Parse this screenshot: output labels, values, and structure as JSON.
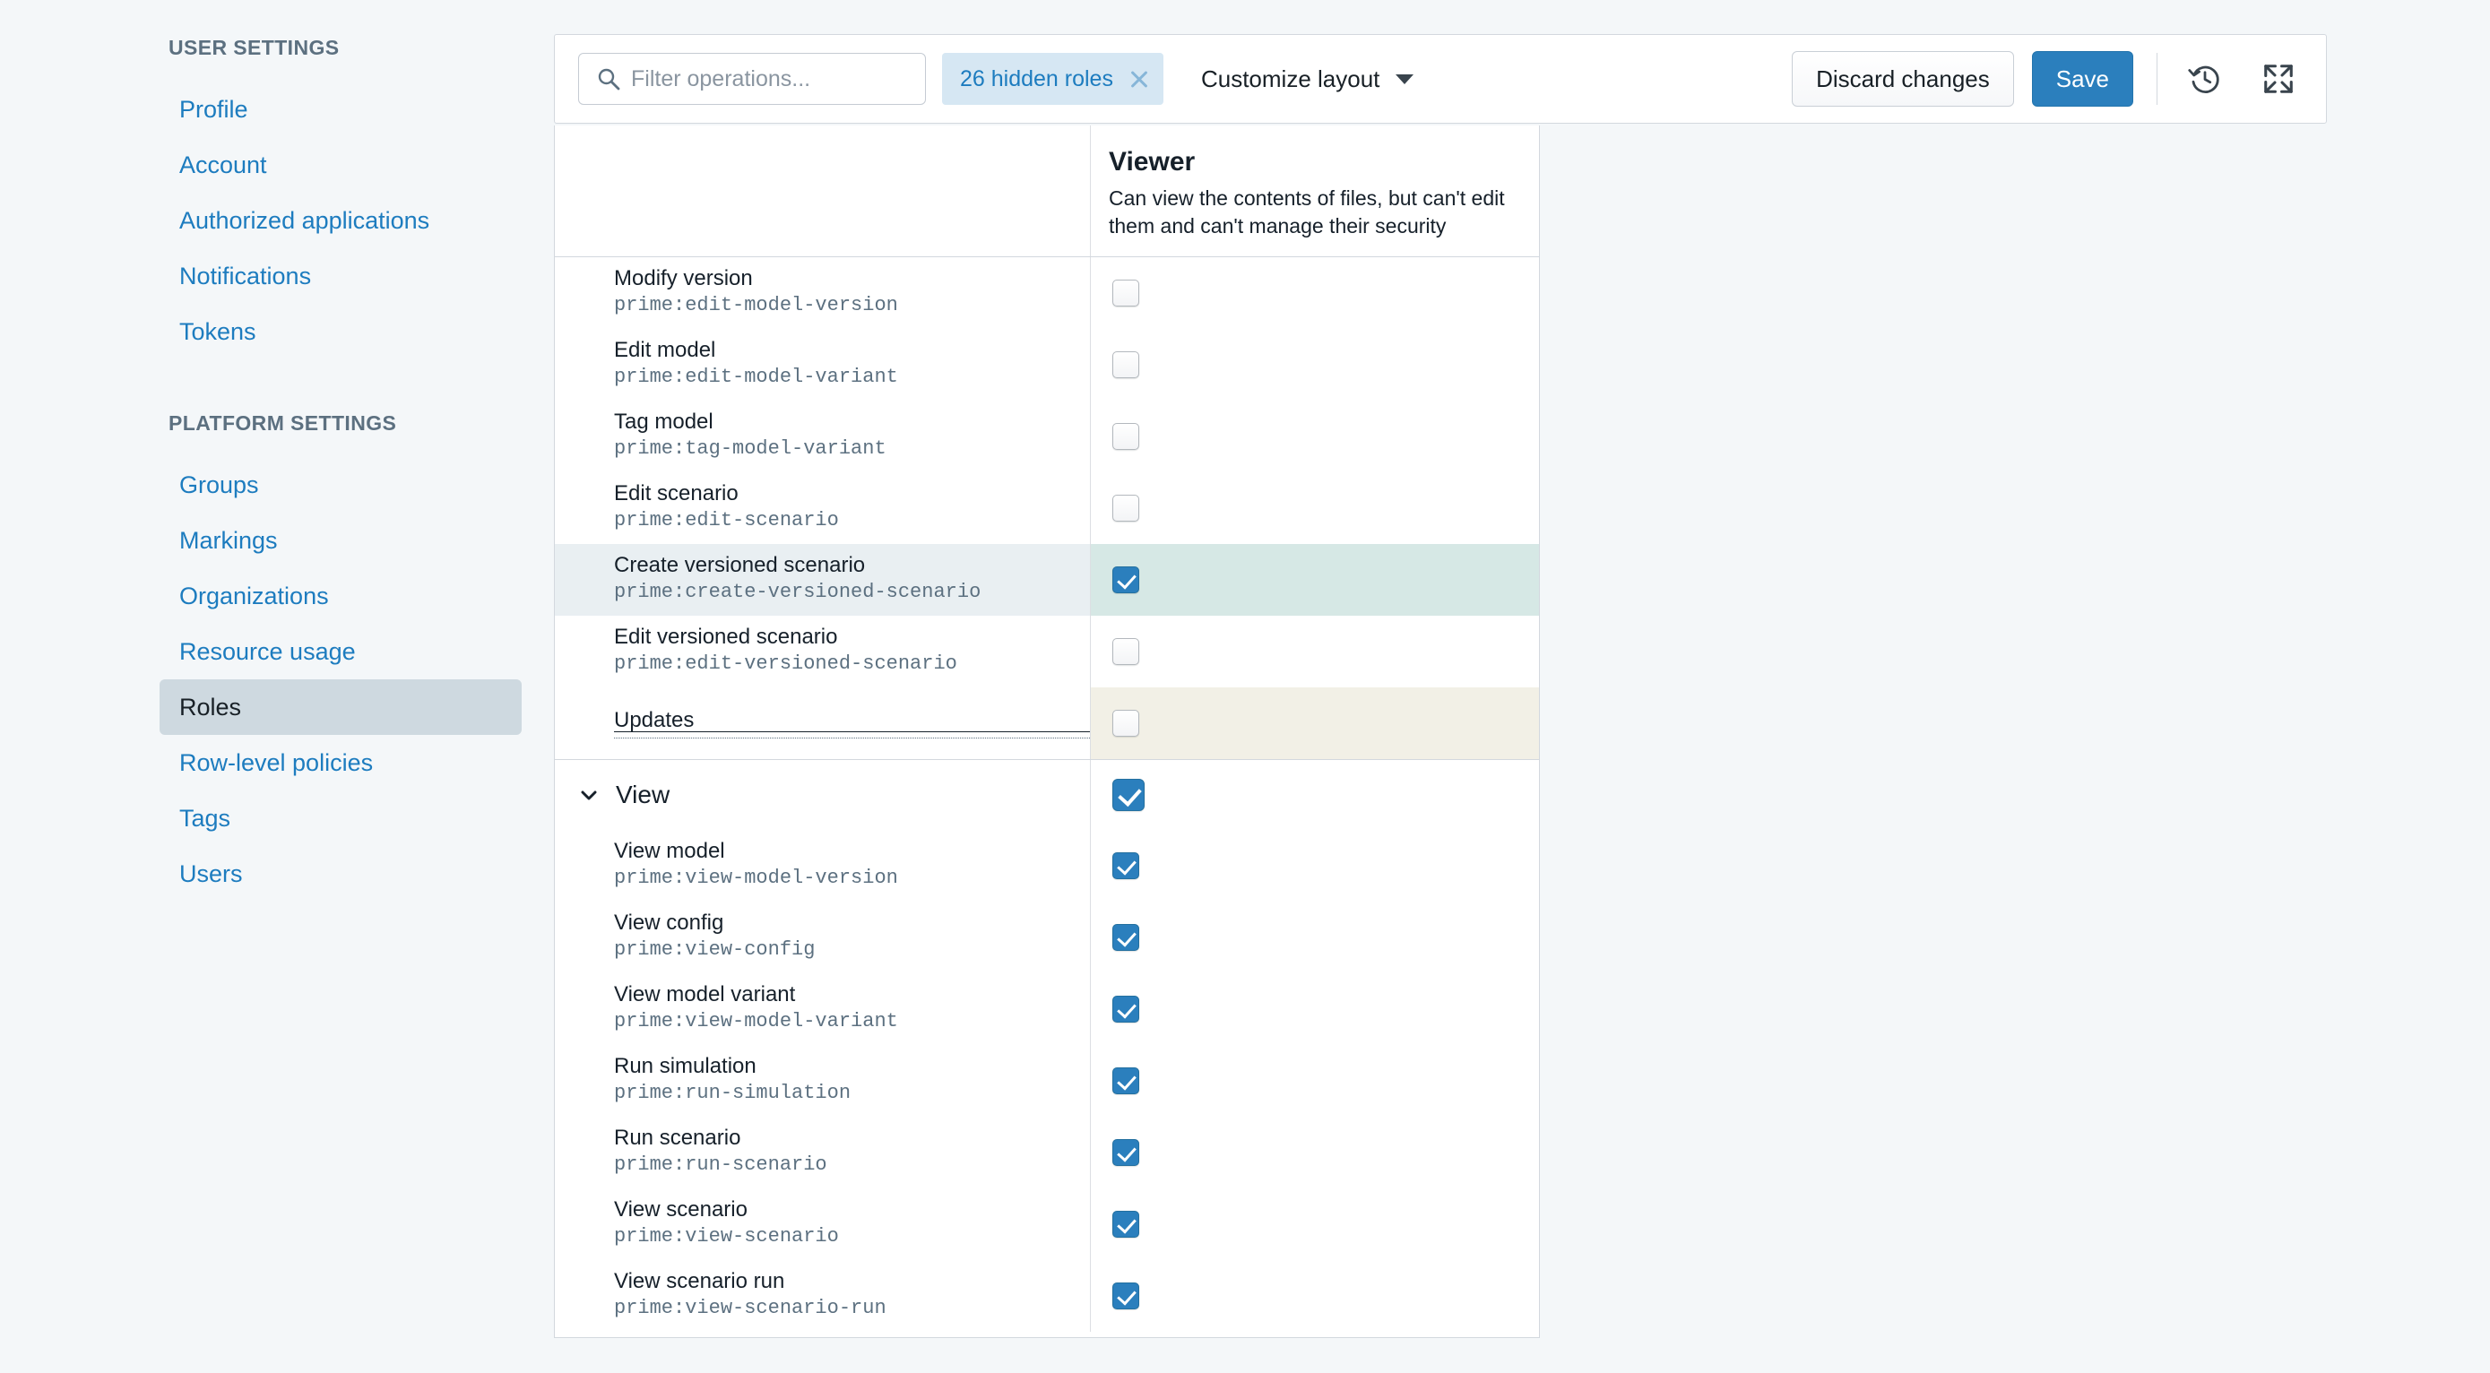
{
  "sidebar": {
    "sections": [
      {
        "title": "USER SETTINGS",
        "items": [
          {
            "label": "Profile",
            "active": false
          },
          {
            "label": "Account",
            "active": false
          },
          {
            "label": "Authorized applications",
            "active": false
          },
          {
            "label": "Notifications",
            "active": false
          },
          {
            "label": "Tokens",
            "active": false
          }
        ]
      },
      {
        "title": "PLATFORM SETTINGS",
        "items": [
          {
            "label": "Groups",
            "active": false
          },
          {
            "label": "Markings",
            "active": false
          },
          {
            "label": "Organizations",
            "active": false
          },
          {
            "label": "Resource usage",
            "active": false
          },
          {
            "label": "Roles",
            "active": true
          },
          {
            "label": "Row-level policies",
            "active": false
          },
          {
            "label": "Tags",
            "active": false
          },
          {
            "label": "Users",
            "active": false
          }
        ]
      }
    ]
  },
  "toolbar": {
    "filter_placeholder": "Filter operations...",
    "filter_value": "",
    "hidden_roles_label": "26 hidden roles",
    "customize_layout_label": "Customize layout",
    "discard_label": "Discard changes",
    "save_label": "Save",
    "history_icon": "history-icon",
    "expand_icon": "expand-icon",
    "search_icon": "search-icon",
    "close_icon": "close-icon"
  },
  "table": {
    "role_column": {
      "name": "Viewer",
      "description": "Can view the contents of files, but can't edit them and can't manage their security"
    },
    "rows": [
      {
        "kind": "operation",
        "name": "Modify version",
        "id": "prime:edit-model-version",
        "checked": false,
        "state": "normal"
      },
      {
        "kind": "operation",
        "name": "Edit model",
        "id": "prime:edit-model-variant",
        "checked": false,
        "state": "normal"
      },
      {
        "kind": "operation",
        "name": "Tag model",
        "id": "prime:tag-model-variant",
        "checked": false,
        "state": "normal"
      },
      {
        "kind": "operation",
        "name": "Edit scenario",
        "id": "prime:edit-scenario",
        "checked": false,
        "state": "normal"
      },
      {
        "kind": "operation",
        "name": "Create versioned scenario",
        "id": "prime:create-versioned-scenario",
        "checked": true,
        "state": "changed"
      },
      {
        "kind": "operation",
        "name": "Edit versioned scenario",
        "id": "prime:edit-versioned-scenario",
        "checked": false,
        "state": "normal"
      },
      {
        "kind": "tooltip",
        "name": "Updates",
        "id": "",
        "checked": false,
        "state": "warn"
      },
      {
        "kind": "group",
        "name": "View",
        "id": "",
        "checked": true,
        "state": "normal"
      },
      {
        "kind": "operation",
        "name": "View model",
        "id": "prime:view-model-version",
        "checked": true,
        "state": "normal"
      },
      {
        "kind": "operation",
        "name": "View config",
        "id": "prime:view-config",
        "checked": true,
        "state": "normal"
      },
      {
        "kind": "operation",
        "name": "View model variant",
        "id": "prime:view-model-variant",
        "checked": true,
        "state": "normal"
      },
      {
        "kind": "operation",
        "name": "Run simulation",
        "id": "prime:run-simulation",
        "checked": true,
        "state": "normal"
      },
      {
        "kind": "operation",
        "name": "Run scenario",
        "id": "prime:run-scenario",
        "checked": true,
        "state": "normal"
      },
      {
        "kind": "operation",
        "name": "View scenario",
        "id": "prime:view-scenario",
        "checked": true,
        "state": "normal"
      },
      {
        "kind": "operation",
        "name": "View scenario run",
        "id": "prime:view-scenario-run",
        "checked": true,
        "state": "normal"
      }
    ]
  },
  "colors": {
    "accent": "#2b7fbd",
    "link": "#1d7cbf",
    "page_bg": "#f4f7f9",
    "changed_cell": "#d6e8e5",
    "warn_cell": "#f2f0e6",
    "active_nav": "#ced9e0"
  }
}
